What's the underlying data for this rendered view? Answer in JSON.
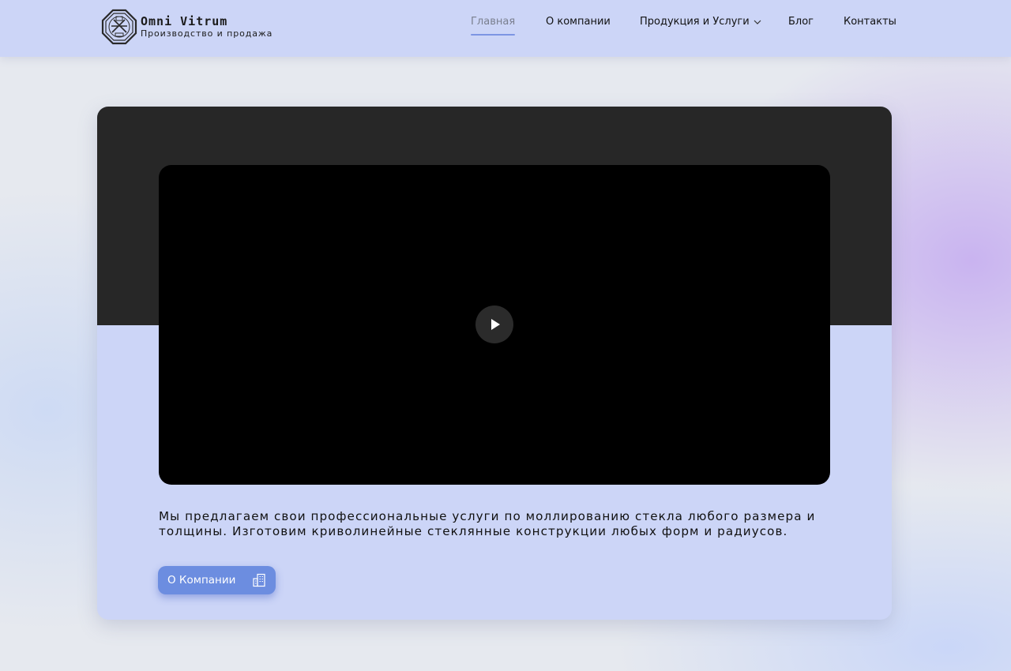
{
  "header": {
    "logo_title": "Omni Vitrum",
    "logo_subtitle": "Производство и продажа",
    "nav": [
      {
        "label": "Главная",
        "active": true
      },
      {
        "label": "О компании",
        "active": false
      },
      {
        "label": "Продукция и Услуги",
        "active": false,
        "has_dropdown": true
      },
      {
        "label": "Блог",
        "active": false
      },
      {
        "label": "Контакты",
        "active": false
      }
    ]
  },
  "hero": {
    "description": "Мы предлагаем свои профессиональные услуги по моллированию стекла любого размера и толщины. Изготовим криволинейные стеклянные конструкции любых форм и радиусов.",
    "button_label": "О Компании",
    "button_icon": "building-icon",
    "video_icon": "play-icon"
  },
  "colors": {
    "header_bg": "#ccd5f7",
    "accent": "#6c8de0",
    "active_underline": "#7d95e3",
    "video_bg": "#000000",
    "card_top": "#272727"
  }
}
